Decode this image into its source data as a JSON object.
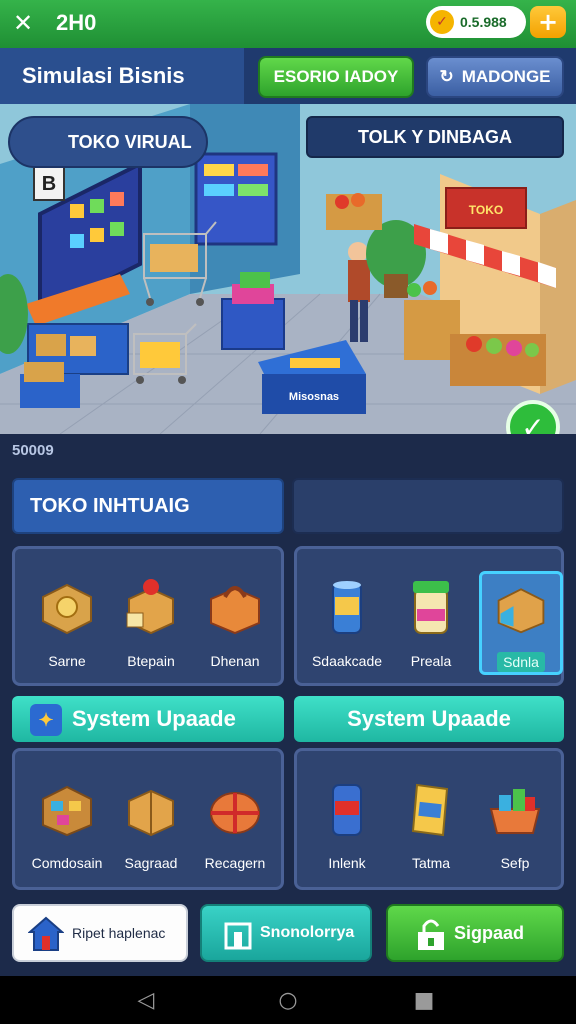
{
  "topbar": {
    "back_icon": "arrow-left-icon",
    "coins": "2H0",
    "balance": "0.5.988",
    "balance_icon": "checkmark-coin-icon",
    "add_label": "+"
  },
  "header": {
    "title": "Simulasi Bisnis",
    "green_button": "ESORIO IADOY",
    "blue_button": "MADONGE",
    "blue_button_icon": "refresh-icon"
  },
  "scene": {
    "store_name": "TOKO VIRUAL",
    "right_label": "TOLK Y DINBAGA",
    "monitor_letter": "B",
    "counter_sign": "Misosnas",
    "shop_sign": "TOKO",
    "check_icon": "checkmark-icon"
  },
  "score": "50009",
  "tabs": {
    "left": "TOKO INHTUAIG",
    "right": ""
  },
  "panels": {
    "top_left": [
      {
        "label": "Sarne",
        "icon": "coin-box-icon"
      },
      {
        "label": "Btepain",
        "icon": "gift-box-icon"
      },
      {
        "label": "Dhenan",
        "icon": "bag-box-icon"
      }
    ],
    "top_right": [
      {
        "label": "Sdaakcade",
        "icon": "can-icon",
        "selected": false
      },
      {
        "label": "Preala",
        "icon": "jar-icon",
        "selected": false
      },
      {
        "label": "Sdnla",
        "icon": "box-icon",
        "selected": true
      }
    ],
    "bottom_left": [
      {
        "label": "Comdosain",
        "icon": "crate-icon"
      },
      {
        "label": "Sagraad",
        "icon": "parcel-icon"
      },
      {
        "label": "Recagern",
        "icon": "wrapped-box-icon"
      }
    ],
    "bottom_right": [
      {
        "label": "Inlenk",
        "icon": "tin-can-icon"
      },
      {
        "label": "Tatma",
        "icon": "snack-bag-icon"
      },
      {
        "label": "Sefp",
        "icon": "basket-icon"
      }
    ]
  },
  "sections": {
    "left": "System Upaade",
    "right": "System Upaade",
    "left_icon": "fox-icon"
  },
  "bottom_buttons": {
    "white": "Ripet haplenac",
    "teal": "Snonolorrya",
    "green": "Sigpaad"
  },
  "colors": {
    "topbar_green": "#2ea32c",
    "header_blue": "#2a4f8f",
    "panel": "#2f4470",
    "teal": "#1fb7a2",
    "accent_orange": "#f3a100"
  }
}
